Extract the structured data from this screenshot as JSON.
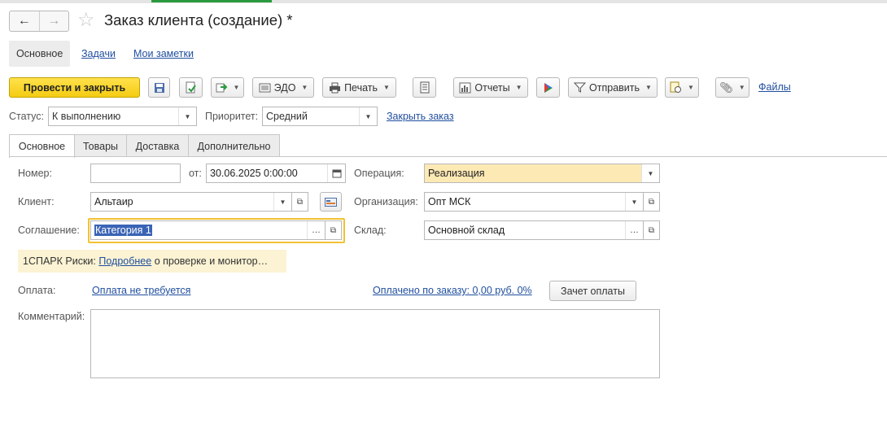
{
  "window": {
    "title": "Заказ клиента (создание) *"
  },
  "nav": {
    "back": "←",
    "forward": "→",
    "star": "☆"
  },
  "subnav": {
    "main": "Основное",
    "tasks": "Задачи",
    "notes": "Мои заметки"
  },
  "toolbar": {
    "post_close": "Провести и закрыть",
    "edo": "ЭДО",
    "print": "Печать",
    "reports": "Отчеты",
    "send": "Отправить",
    "files": "Файлы"
  },
  "status": {
    "label": "Статус:",
    "value": "К выполнению"
  },
  "priority": {
    "label": "Приоритет:",
    "value": "Средний"
  },
  "close_order": "Закрыть заказ",
  "tabs": [
    "Основное",
    "Товары",
    "Доставка",
    "Дополнительно"
  ],
  "form": {
    "number_label": "Номер:",
    "number_value": "",
    "date_label": "от:",
    "date_value": "30.06.2025  0:00:00",
    "operation_label": "Операция:",
    "operation_value": "Реализация",
    "client_label": "Клиент:",
    "client_value": "Альтаир",
    "org_label": "Организация:",
    "org_value": "Опт МСК",
    "agreement_label": "Соглашение:",
    "agreement_value": "Категория 1",
    "warehouse_label": "Склад:",
    "warehouse_value": "Основной склад",
    "spark_prefix": "1СПАРК Риски:",
    "spark_link": "Подробнее",
    "spark_text": "о проверке и монитор…",
    "payment_label": "Оплата:",
    "payment_link": "Оплата не требуется",
    "paid_link": "Оплачено по заказу: 0,00 руб. 0%",
    "offset_button": "Зачет оплаты",
    "comment_label": "Комментарий:",
    "comment_value": ""
  },
  "colors": {
    "primary": "#f4cc12",
    "link": "#1f4e9e",
    "highlight_field": "#fde9b4",
    "selection": "#3a64b5",
    "spark_bg": "#fbf3d3"
  }
}
